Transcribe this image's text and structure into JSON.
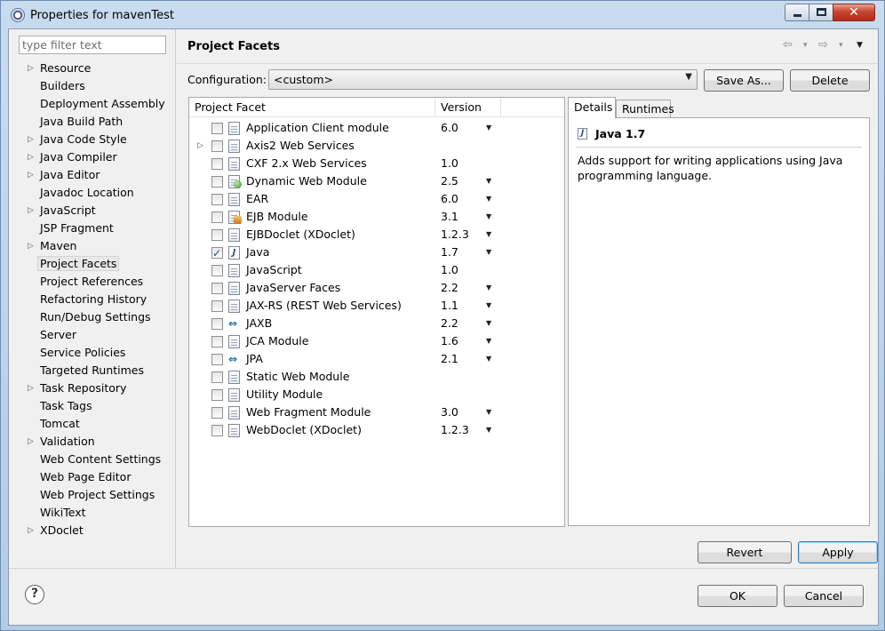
{
  "window": {
    "title": "Properties for mavenTest",
    "close_glyph": "✕"
  },
  "filter": {
    "placeholder": "type filter text"
  },
  "tree": [
    {
      "label": "Resource",
      "expandable": true
    },
    {
      "label": "Builders",
      "expandable": false
    },
    {
      "label": "Deployment Assembly",
      "expandable": false
    },
    {
      "label": "Java Build Path",
      "expandable": false
    },
    {
      "label": "Java Code Style",
      "expandable": true
    },
    {
      "label": "Java Compiler",
      "expandable": true
    },
    {
      "label": "Java Editor",
      "expandable": true
    },
    {
      "label": "Javadoc Location",
      "expandable": false
    },
    {
      "label": "JavaScript",
      "expandable": true
    },
    {
      "label": "JSP Fragment",
      "expandable": false
    },
    {
      "label": "Maven",
      "expandable": true
    },
    {
      "label": "Project Facets",
      "expandable": false,
      "selected": true
    },
    {
      "label": "Project References",
      "expandable": false
    },
    {
      "label": "Refactoring History",
      "expandable": false
    },
    {
      "label": "Run/Debug Settings",
      "expandable": false
    },
    {
      "label": "Server",
      "expandable": false
    },
    {
      "label": "Service Policies",
      "expandable": false
    },
    {
      "label": "Targeted Runtimes",
      "expandable": false
    },
    {
      "label": "Task Repository",
      "expandable": true
    },
    {
      "label": "Task Tags",
      "expandable": false
    },
    {
      "label": "Tomcat",
      "expandable": false
    },
    {
      "label": "Validation",
      "expandable": true
    },
    {
      "label": "Web Content Settings",
      "expandable": false
    },
    {
      "label": "Web Page Editor",
      "expandable": false
    },
    {
      "label": "Web Project Settings",
      "expandable": false
    },
    {
      "label": "WikiText",
      "expandable": false
    },
    {
      "label": "XDoclet",
      "expandable": true
    }
  ],
  "page": {
    "title": "Project Facets",
    "nav": {
      "back": "⇦",
      "forward": "⇨",
      "dropdown": "▾",
      "menu": "▼"
    }
  },
  "configuration": {
    "label": "Configuration:",
    "value": "<custom>",
    "save_as": "Save As...",
    "delete": "Delete"
  },
  "facets": {
    "col_facet": "Project Facet",
    "col_version": "Version",
    "rows": [
      {
        "name": "Application Client module",
        "version": "6.0",
        "checked": false,
        "dropdown": true,
        "icon": "page"
      },
      {
        "name": "Axis2 Web Services",
        "version": "",
        "checked": false,
        "dropdown": false,
        "icon": "page",
        "expandable": true
      },
      {
        "name": "CXF 2.x Web Services",
        "version": "1.0",
        "checked": false,
        "dropdown": false,
        "icon": "page"
      },
      {
        "name": "Dynamic Web Module",
        "version": "2.5",
        "checked": false,
        "dropdown": true,
        "icon": "globe"
      },
      {
        "name": "EAR",
        "version": "6.0",
        "checked": false,
        "dropdown": true,
        "icon": "page"
      },
      {
        "name": "EJB Module",
        "version": "3.1",
        "checked": false,
        "dropdown": true,
        "icon": "ejb"
      },
      {
        "name": "EJBDoclet (XDoclet)",
        "version": "1.2.3",
        "checked": false,
        "dropdown": true,
        "icon": "page"
      },
      {
        "name": "Java",
        "version": "1.7",
        "checked": true,
        "dropdown": true,
        "icon": "java"
      },
      {
        "name": "JavaScript",
        "version": "1.0",
        "checked": false,
        "dropdown": false,
        "icon": "page"
      },
      {
        "name": "JavaServer Faces",
        "version": "2.2",
        "checked": false,
        "dropdown": true,
        "icon": "page"
      },
      {
        "name": "JAX-RS (REST Web Services)",
        "version": "1.1",
        "checked": false,
        "dropdown": true,
        "icon": "page"
      },
      {
        "name": "JAXB",
        "version": "2.2",
        "checked": false,
        "dropdown": true,
        "icon": "swap"
      },
      {
        "name": "JCA Module",
        "version": "1.6",
        "checked": false,
        "dropdown": true,
        "icon": "page"
      },
      {
        "name": "JPA",
        "version": "2.1",
        "checked": false,
        "dropdown": true,
        "icon": "swap"
      },
      {
        "name": "Static Web Module",
        "version": "",
        "checked": false,
        "dropdown": false,
        "icon": "page"
      },
      {
        "name": "Utility Module",
        "version": "",
        "checked": false,
        "dropdown": false,
        "icon": "page"
      },
      {
        "name": "Web Fragment Module",
        "version": "3.0",
        "checked": false,
        "dropdown": true,
        "icon": "page"
      },
      {
        "name": "WebDoclet (XDoclet)",
        "version": "1.2.3",
        "checked": false,
        "dropdown": true,
        "icon": "page"
      }
    ]
  },
  "details": {
    "tab_details": "Details",
    "tab_runtimes": "Runtimes",
    "title": "Java 1.7",
    "description": "Adds support for writing applications using Java programming language."
  },
  "buttons": {
    "revert": "Revert",
    "apply": "Apply",
    "ok": "OK",
    "cancel": "Cancel",
    "help": "?"
  }
}
